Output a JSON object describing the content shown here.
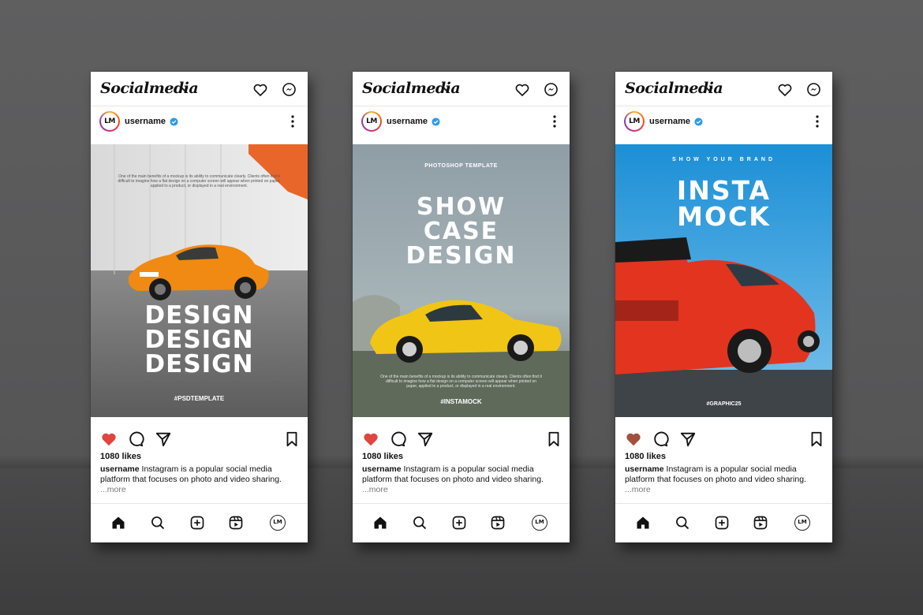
{
  "app": {
    "brand": "Socialmedia",
    "avatar_initials": "LM"
  },
  "posts": [
    {
      "username": "username",
      "small_text": "One of the main benefits of a mockup is its ability to communicate clearly. Clients often find it difficult to imagine how a flat design on a computer screen will appear when printed on paper, applied to a product, or displayed in a real environment.",
      "headline": [
        "DESIGN",
        "DESIGN",
        "DESIGN"
      ],
      "hashtag": "#PSDTEMPLATE",
      "likes": "1080 likes",
      "caption_user": "username",
      "caption_text": "Instagram is a popular social media platform that focuses on photo and video sharing.",
      "more_label": "...more"
    },
    {
      "username": "username",
      "kicker": "PHOTOSHOP TEMPLATE",
      "headline": [
        "SHOW",
        "CASE",
        "DESIGN"
      ],
      "small_text": "One of the main benefits of a mockup is its ability to communicate clearly. Clients often find it difficult to imagine how a flat design on a computer screen will appear when printed on paper, applied to a product, or displayed in a real environment.",
      "hashtag": "#INSTAMOCK",
      "likes": "1080 likes",
      "caption_user": "username",
      "caption_text": "Instagram is a popular social media platform that focuses on photo and video sharing.",
      "more_label": "...more"
    },
    {
      "username": "username",
      "kicker": "SHOW YOUR BRAND",
      "headline": [
        "INSTA",
        "MOCK"
      ],
      "hashtag": "#GRAPHIC25",
      "likes": "1080 likes",
      "caption_user": "username",
      "caption_text": "Instagram is a popular social media platform that focuses on photo and video sharing.",
      "more_label": "...more"
    }
  ],
  "icons": {
    "top": [
      "chevron-down-icon",
      "heart-icon",
      "messenger-icon"
    ],
    "post": [
      "verified-badge-icon",
      "more-options-icon"
    ],
    "actions": [
      "like-heart-icon",
      "comment-icon",
      "share-icon",
      "bookmark-icon"
    ],
    "nav": [
      "home-icon",
      "search-icon",
      "create-icon",
      "reels-icon",
      "profile-icon"
    ]
  },
  "colors": {
    "like": "#e0453f",
    "like_third": "#a0523a",
    "verified": "#2f9ae8",
    "sky_blue": "#1c8fd6"
  }
}
